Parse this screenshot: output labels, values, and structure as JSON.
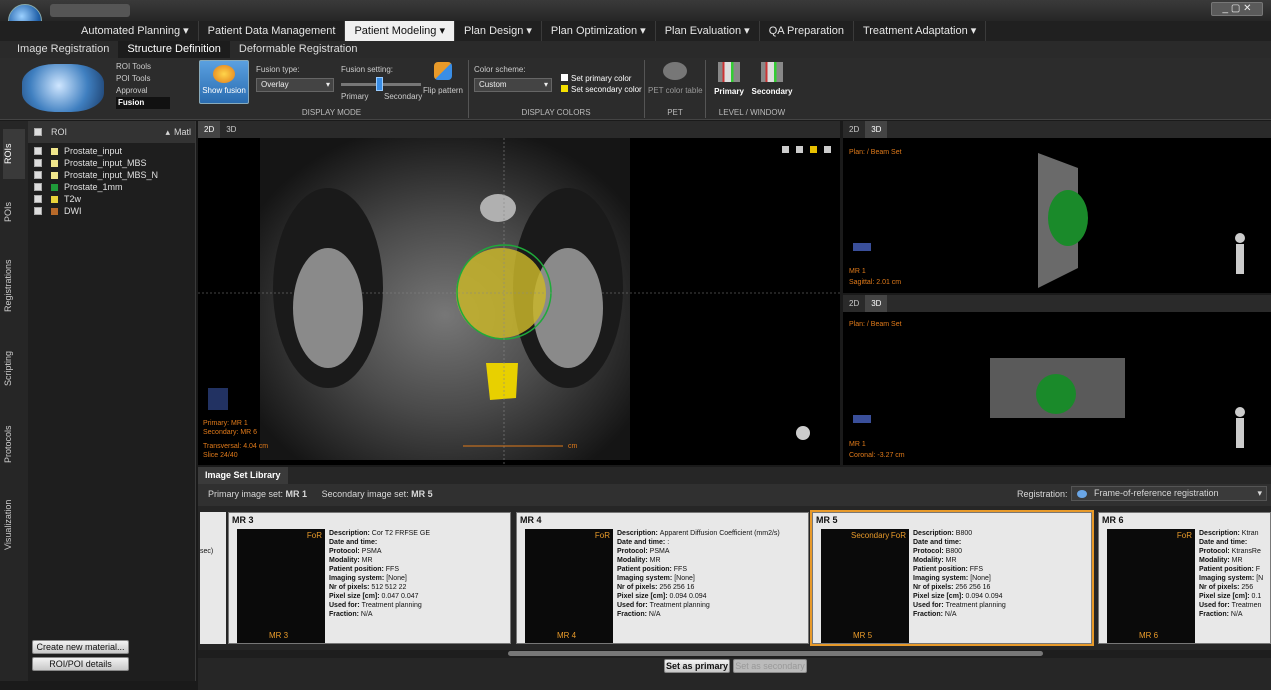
{
  "menu": [
    "Automated Planning ▾",
    "Patient Data Management",
    "Patient Modeling ▾",
    "Plan Design ▾",
    "Plan Optimization ▾",
    "Plan Evaluation ▾",
    "QA Preparation",
    "Treatment Adaptation ▾"
  ],
  "subtabs": [
    "Image Registration",
    "Structure Definition",
    "Deformable Registration"
  ],
  "ribbon": {
    "tools": [
      "ROI Tools",
      "POI Tools",
      "Approval",
      "Fusion"
    ],
    "show_fusion": "Show fusion",
    "fusion_type_label": "Fusion type:",
    "fusion_type": "Overlay",
    "fusion_setting_label": "Fusion setting:",
    "primary": "Primary",
    "secondary": "Secondary",
    "flip": "Flip pattern",
    "display_mode": "DISPLAY MODE",
    "color_scheme_label": "Color scheme:",
    "color_scheme": "Custom",
    "set_primary_color": "Set primary color",
    "set_secondary_color": "Set secondary color",
    "display_colors": "DISPLAY COLORS",
    "pet_color_table": "PET color table",
    "pet": "PET",
    "lw_primary": "Primary",
    "lw_secondary": "Secondary",
    "level_window": "LEVEL / WINDOW"
  },
  "sidebar": [
    "ROIs",
    "POIs",
    "Registrations",
    "Scripting",
    "Protocols",
    "Visualization"
  ],
  "roi": {
    "header": "ROI",
    "header2": "Matl",
    "rows": [
      {
        "name": "Prostate_input",
        "color": "#f0e68c"
      },
      {
        "name": "Prostate_input_MBS",
        "color": "#f0e68c"
      },
      {
        "name": "Prostate_input_MBS_N",
        "color": "#f0e68c"
      },
      {
        "name": "Prostate_1mm",
        "color": "#1f9a3a"
      },
      {
        "name": "T2w",
        "color": "#e8d23a"
      },
      {
        "name": "DWI",
        "color": "#b86a2a"
      }
    ],
    "create": "Create new material...",
    "details": "ROI/POI details"
  },
  "viewer": {
    "tab2d": "2D",
    "tab3d": "3D",
    "primary": "Primary: MR 1",
    "secondary": "Secondary: MR 6",
    "transversal": "Transversal: 4.04 cm",
    "slice": "Slice 24/40",
    "scale": "cm"
  },
  "tr": {
    "tab2d": "2D",
    "tab3d": "3D",
    "plan": "Plan: / Beam Set",
    "mr": "MR 1",
    "pos": "Sagittal: 2.01 cm"
  },
  "br": {
    "tab2d": "2D",
    "tab3d": "3D",
    "plan": "Plan: / Beam Set",
    "mr": "MR 1",
    "pos": "Coronal: -3.27 cm"
  },
  "library": {
    "tab": "Image Set Library",
    "primary_label": "Primary image set:",
    "primary": "MR 1",
    "secondary_label": "Secondary image set:",
    "secondary": "MR 5",
    "registration_label": "Registration:",
    "registration": "Frame-of-reference registration",
    "left_stub": "sec)",
    "set_primary": "Set as primary",
    "set_secondary": "Set as secondary",
    "cards": [
      {
        "title": "MR 3",
        "for": "FoR",
        "tag": "",
        "thumb": "MR 3",
        "desc": "Cor T2 FRFSE GE",
        "date": "",
        "protocol": "PSMA",
        "modality": "MR",
        "position": "FFS",
        "system": "[None]",
        "pixels": "512  512  22",
        "size": "0.047  0.047",
        "used": "Treatment planning",
        "fraction": "N/A"
      },
      {
        "title": "MR 4",
        "for": "FoR",
        "tag": "",
        "thumb": "MR 4",
        "desc": "Apparent Diffusion Coefficient (mm2/s)",
        "date": ":",
        "protocol": "PSMA",
        "modality": "MR",
        "position": "FFS",
        "system": "[None]",
        "pixels": "256  256  16",
        "size": "0.094  0.094",
        "used": "Treatment planning",
        "fraction": "N/A"
      },
      {
        "title": "MR 5",
        "for": "FoR",
        "tag": "Secondary",
        "thumb": "MR 5",
        "desc": "B800",
        "date": "",
        "protocol": "B800",
        "modality": "MR",
        "position": "FFS",
        "system": "[None]",
        "pixels": "256  256  16",
        "size": "0.094  0.094",
        "used": "Treatment planning",
        "fraction": "N/A"
      },
      {
        "title": "MR 6",
        "for": "FoR",
        "tag": "",
        "thumb": "MR 6",
        "desc": "Ktran",
        "date": "",
        "protocol": "KtransRe",
        "modality": "MR",
        "position": "F",
        "system": "[N",
        "pixels": "256",
        "size": "0.1",
        "used": "Treatmen",
        "fraction": "N/A"
      }
    ]
  }
}
